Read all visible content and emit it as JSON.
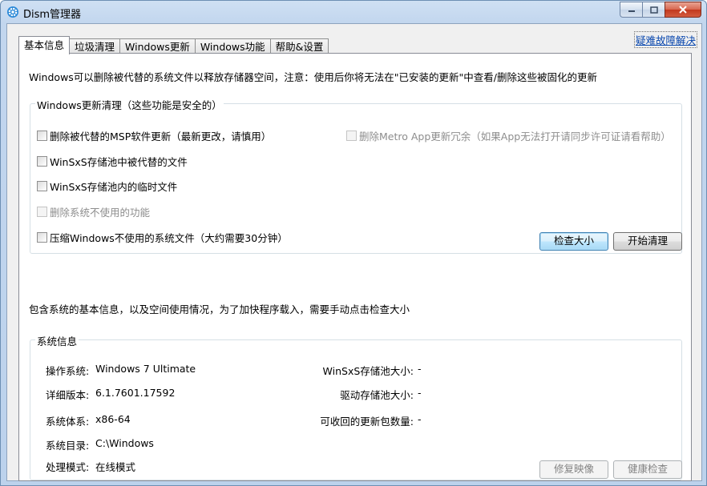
{
  "window": {
    "title": "Dism管理器"
  },
  "tabs": [
    {
      "label": "基本信息",
      "active": true
    },
    {
      "label": "垃圾清理",
      "active": false
    },
    {
      "label": "Windows更新",
      "active": false
    },
    {
      "label": "Windows功能",
      "active": false
    },
    {
      "label": "帮助&设置",
      "active": false
    }
  ],
  "help_link": "疑难故障解决",
  "notice": "Windows可以删除被代替的系统文件以释放存储器空间，注意：使用后你将无法在\"已安装的更新\"中查看/删除这些被固化的更新",
  "cleanup": {
    "legend": "Windows更新清理（这些功能是安全的）",
    "options": [
      {
        "label": "删除被代替的MSP软件更新（最新更改，请慎用）",
        "enabled": true
      },
      {
        "label": "删除Metro App更新冗余（如果App无法打开请同步许可证请看帮助）",
        "enabled": false
      },
      {
        "label": "WinSxS存储池中被代替的文件",
        "enabled": true
      },
      {
        "label": "WinSxS存储池内的临时文件",
        "enabled": true
      },
      {
        "label": "删除系统不使用的功能",
        "enabled": false
      },
      {
        "label": "压缩Windows不使用的系统文件（大约需要30分钟）",
        "enabled": true
      }
    ],
    "check_size_button": "检查大小",
    "start_clean_button": "开始清理"
  },
  "info_text": "包含系统的基本信息，以及空间使用情况，为了加快程序载入，需要手动点击检查大小",
  "system_info": {
    "legend": "系统信息",
    "os": {
      "label": "操作系统:",
      "value": "Windows 7 Ultimate"
    },
    "version": {
      "label": "详细版本:",
      "value": "6.1.7601.17592"
    },
    "arch": {
      "label": "系统体系:",
      "value": "x86-64"
    },
    "dir": {
      "label": "系统目录:",
      "value": "C:\\Windows"
    },
    "mode": {
      "label": "处理模式:",
      "value": "在线模式"
    },
    "winsxs": {
      "label": "WinSxS存储池大小:",
      "value": "-"
    },
    "driver_store": {
      "label": "驱动存储池大小:",
      "value": "-"
    },
    "reclaimable": {
      "label": "可收回的更新包数量:",
      "value": "-"
    },
    "repair_button": "修复映像",
    "health_button": "健康检查"
  }
}
